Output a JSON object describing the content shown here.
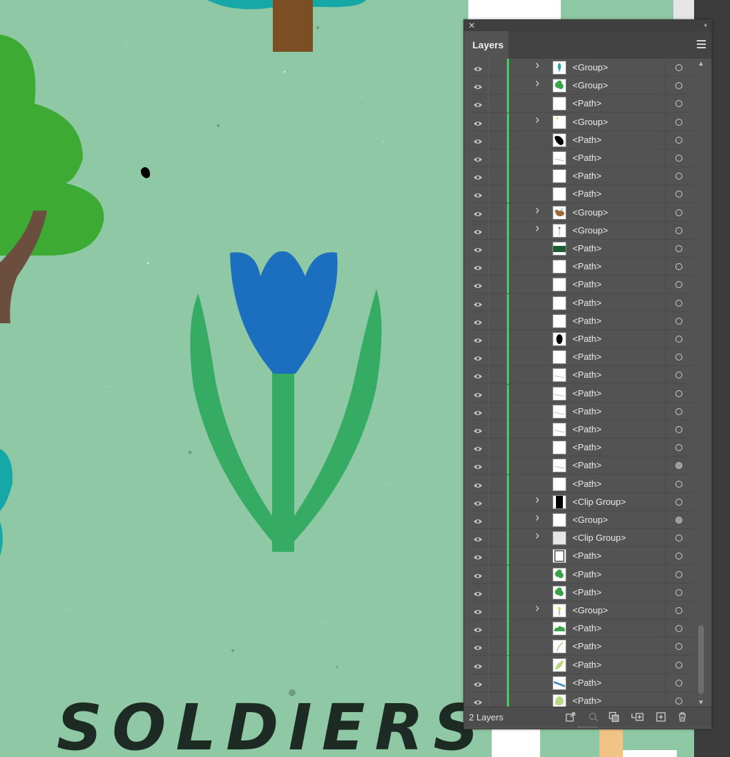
{
  "canvas": {
    "background_color": "#8fc8a4",
    "text": "SOLDIERS",
    "flower_color": "#1c6fbf",
    "stem_color": "#35ab63",
    "tree_color": "#3daa34"
  },
  "panel": {
    "title": "Layers",
    "close_icon": "close-icon",
    "collapse_icon": "double-chevron-left-icon",
    "menu_icon": "hamburger-menu-icon",
    "layer_count": "2 Layers",
    "accent_color": "#3fd45a",
    "layers": [
      {
        "name": "<Group>",
        "expand": true,
        "thumb": "teal-shape",
        "target_filled": false
      },
      {
        "name": "<Group>",
        "expand": true,
        "thumb": "green-tree",
        "target_filled": false
      },
      {
        "name": "<Path>",
        "expand": false,
        "thumb": "blank",
        "target_filled": false
      },
      {
        "name": "<Group>",
        "expand": true,
        "thumb": "yellow-dot",
        "target_filled": false
      },
      {
        "name": "<Path>",
        "expand": false,
        "thumb": "black-blob",
        "target_filled": false
      },
      {
        "name": "<Path>",
        "expand": false,
        "thumb": "thin-line",
        "target_filled": false
      },
      {
        "name": "<Path>",
        "expand": false,
        "thumb": "blank",
        "target_filled": false
      },
      {
        "name": "<Path>",
        "expand": false,
        "thumb": "blank",
        "target_filled": false
      },
      {
        "name": "<Group>",
        "expand": true,
        "thumb": "brown-bird",
        "target_filled": false
      },
      {
        "name": "<Group>",
        "expand": true,
        "thumb": "blue-sprig",
        "target_filled": false
      },
      {
        "name": "<Path>",
        "expand": false,
        "thumb": "dark-green-bar",
        "target_filled": false
      },
      {
        "name": "<Path>",
        "expand": false,
        "thumb": "blank",
        "target_filled": false
      },
      {
        "name": "<Path>",
        "expand": false,
        "thumb": "blank",
        "target_filled": false
      },
      {
        "name": "<Path>",
        "expand": false,
        "thumb": "blank",
        "target_filled": false
      },
      {
        "name": "<Path>",
        "expand": false,
        "thumb": "blank",
        "target_filled": false
      },
      {
        "name": "<Path>",
        "expand": false,
        "thumb": "black-oval",
        "target_filled": false
      },
      {
        "name": "<Path>",
        "expand": false,
        "thumb": "blank",
        "target_filled": false
      },
      {
        "name": "<Path>",
        "expand": false,
        "thumb": "thin-line",
        "target_filled": false
      },
      {
        "name": "<Path>",
        "expand": false,
        "thumb": "thin-line",
        "target_filled": false
      },
      {
        "name": "<Path>",
        "expand": false,
        "thumb": "thin-line",
        "target_filled": false
      },
      {
        "name": "<Path>",
        "expand": false,
        "thumb": "thin-line",
        "target_filled": false
      },
      {
        "name": "<Path>",
        "expand": false,
        "thumb": "blank",
        "target_filled": false
      },
      {
        "name": "<Path>",
        "expand": false,
        "thumb": "thin-line",
        "target_filled": true
      },
      {
        "name": "<Path>",
        "expand": false,
        "thumb": "blank",
        "target_filled": false
      },
      {
        "name": "<Clip Group>",
        "expand": true,
        "thumb": "black-rect",
        "target_filled": false
      },
      {
        "name": "<Group>",
        "expand": true,
        "thumb": "blank",
        "target_filled": true
      },
      {
        "name": "<Clip Group>",
        "expand": true,
        "thumb": "light-gray",
        "target_filled": false
      },
      {
        "name": "<Path>",
        "expand": false,
        "thumb": "outlined-rect",
        "target_filled": false
      },
      {
        "name": "<Path>",
        "expand": false,
        "thumb": "green-tree",
        "target_filled": false
      },
      {
        "name": "<Path>",
        "expand": false,
        "thumb": "green-tree",
        "target_filled": false
      },
      {
        "name": "<Group>",
        "expand": true,
        "thumb": "yellow-flower",
        "target_filled": false
      },
      {
        "name": "<Path>",
        "expand": false,
        "thumb": "green-bush",
        "target_filled": false
      },
      {
        "name": "<Path>",
        "expand": false,
        "thumb": "orange-line",
        "target_filled": false
      },
      {
        "name": "<Path>",
        "expand": false,
        "thumb": "light-green-leaf",
        "target_filled": false
      },
      {
        "name": "<Path>",
        "expand": false,
        "thumb": "blue-stripe",
        "target_filled": false
      },
      {
        "name": "<Path>",
        "expand": false,
        "thumb": "pale-green-blob",
        "target_filled": false
      }
    ],
    "footer_icons": [
      "export-icon",
      "search-icon",
      "make-clipping-mask-icon",
      "create-sublayer-icon",
      "new-layer-icon",
      "trash-icon"
    ]
  }
}
